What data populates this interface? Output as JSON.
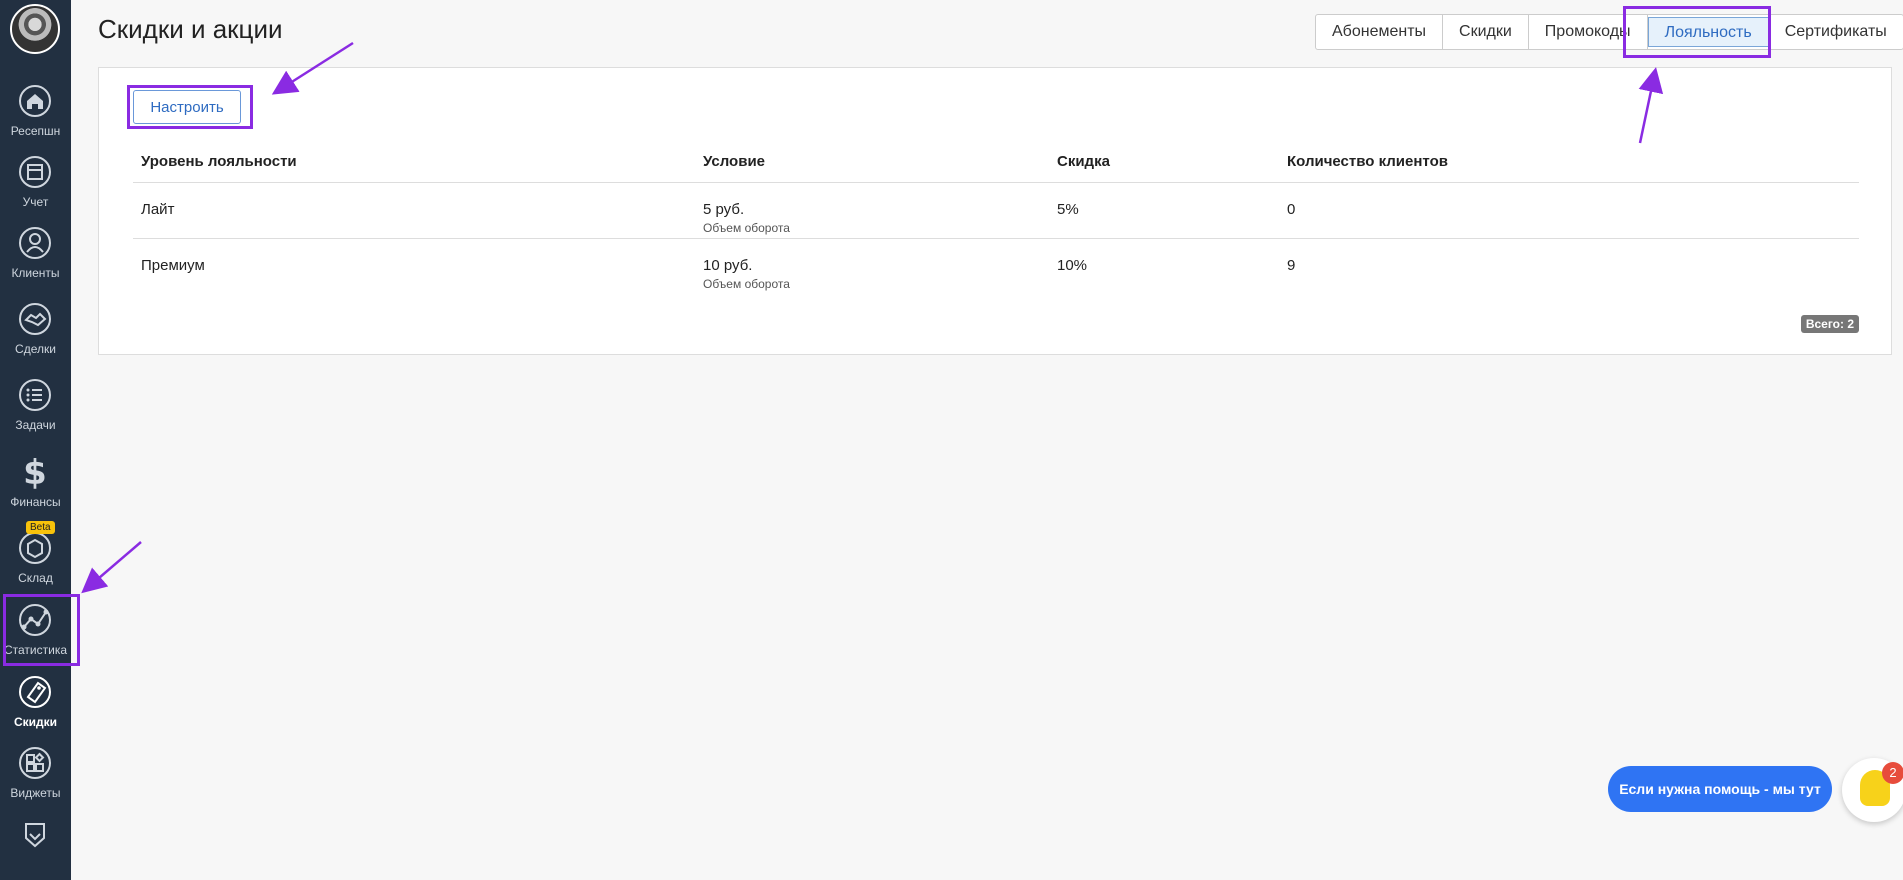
{
  "sidebar": {
    "items": [
      {
        "label": "Ресепшн",
        "icon": "home-icon"
      },
      {
        "label": "Учет",
        "icon": "calendar-icon"
      },
      {
        "label": "Клиенты",
        "icon": "user-icon"
      },
      {
        "label": "Сделки",
        "icon": "handshake-icon"
      },
      {
        "label": "Задачи",
        "icon": "task-list-icon"
      },
      {
        "label": "Финансы",
        "icon": "dollar-icon"
      },
      {
        "label": "Склад",
        "icon": "box-icon",
        "badge": "Beta"
      },
      {
        "label": "Статистика",
        "icon": "chart-icon"
      },
      {
        "label": "Скидки",
        "icon": "sale-tag-icon"
      },
      {
        "label": "Виджеты",
        "icon": "widgets-icon"
      }
    ]
  },
  "header": {
    "title": "Скидки и акции",
    "tabs": [
      {
        "label": "Абонементы"
      },
      {
        "label": "Скидки"
      },
      {
        "label": "Промокоды"
      },
      {
        "label": "Лояльность"
      },
      {
        "label": "Сертификаты"
      }
    ]
  },
  "panel": {
    "configure_label": "Настроить",
    "columns": [
      "Уровень лояльности",
      "Условие",
      "Скидка",
      "Количество клиентов"
    ],
    "rows": [
      {
        "level": "Лайт",
        "condition": "5 руб.",
        "condition_note": "Объем оборота",
        "discount": "5%",
        "clients": "0"
      },
      {
        "level": "Премиум",
        "condition": "10 руб.",
        "condition_note": "Объем оборота",
        "discount": "10%",
        "clients": "9"
      }
    ],
    "total": "Всего: 2"
  },
  "help": {
    "label": "Если нужна помощь - мы тут",
    "badge": "2"
  },
  "colors": {
    "sidebar_bg": "#223041",
    "accent": "#2e6bc1",
    "highlight": "#8a2be2",
    "help_bg": "#2f74f3"
  }
}
